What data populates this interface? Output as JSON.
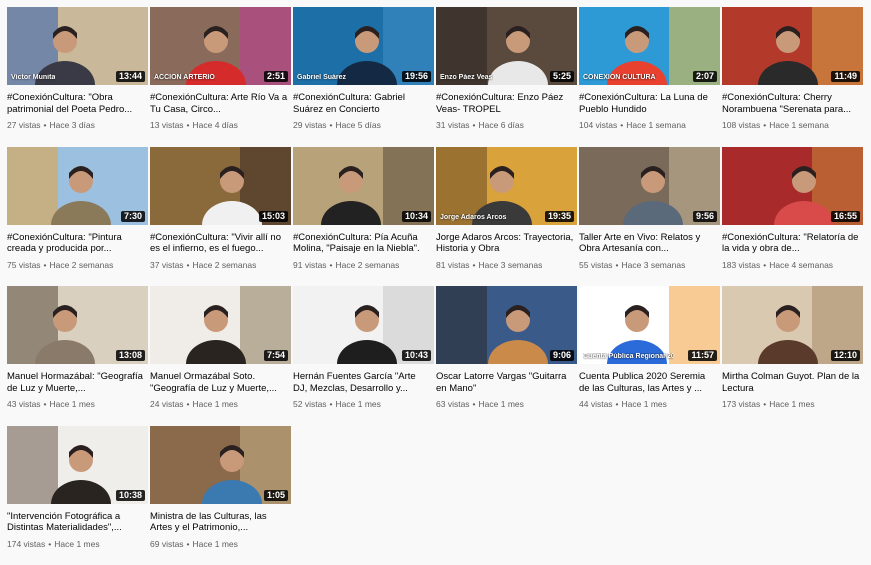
{
  "videos": [
    {
      "title": "#ConexiónCultura: \"Obra patrimonial del Poeta Pedro...",
      "views": "27 vistas",
      "age": "Hace 3 días",
      "duration": "13:44",
      "thumb_colors": [
        "#c9b99a",
        "#3a3a46",
        "#2f5fb3"
      ],
      "overlay_text": "Víctor Munita"
    },
    {
      "title": "#ConexiónCultura: Arte Río Va a Tu Casa, Circo...",
      "views": "13 vistas",
      "age": "Hace 4 días",
      "duration": "2:51",
      "thumb_colors": [
        "#8a6a5a",
        "#d62b2b",
        "#c23a9a"
      ],
      "overlay_text": "ACCIÓN ARTERIO"
    },
    {
      "title": "#ConexiónCultura: Gabriel Suárez en Concierto",
      "views": "29 vistas",
      "age": "Hace 5 días",
      "duration": "19:56",
      "thumb_colors": [
        "#1d6fa8",
        "#142a44",
        "#3f8fc9"
      ],
      "overlay_text": "Gabriel Suárez"
    },
    {
      "title": "#ConexiónCultura: Enzo Páez Veas- TROPEL",
      "views": "31 vistas",
      "age": "Hace 6 días",
      "duration": "5:25",
      "thumb_colors": [
        "#5a4a3e",
        "#e8e8e8",
        "#2a2420"
      ],
      "overlay_text": "Enzo Páez Veas"
    },
    {
      "title": "#ConexiónCultura: La Luna de Pueblo Hundido",
      "views": "104 vistas",
      "age": "Hace 1 semana",
      "duration": "2:07",
      "thumb_colors": [
        "#2d9ad6",
        "#e8412f",
        "#f5c23a"
      ],
      "overlay_text": "CONEXIÓN CULTURA"
    },
    {
      "title": "#ConexiónCultura: Cherry Norambuena \"Serenata para...",
      "views": "108 vistas",
      "age": "Hace 1 semana",
      "duration": "11:49",
      "thumb_colors": [
        "#b33a2a",
        "#2a2a2a",
        "#d9a54a"
      ],
      "overlay_text": ""
    },
    {
      "title": "#ConexiónCultura: \"Pintura creada y producida por...",
      "views": "75 vistas",
      "age": "Hace 2 semanas",
      "duration": "7:30",
      "thumb_colors": [
        "#9cc0e0",
        "#8a7a5a",
        "#e8a23a"
      ],
      "overlay_text": ""
    },
    {
      "title": "#ConexiónCultura: \"Vivir allí no es el infierno, es el fuego...",
      "views": "37 vistas",
      "age": "Hace 2 semanas",
      "duration": "15:03",
      "thumb_colors": [
        "#8a6a3a",
        "#f0f0f0",
        "#3a2a24"
      ],
      "overlay_text": ""
    },
    {
      "title": "#ConexiónCultura: Pía Acuña Molina, \"Paisaje en la Niebla\".",
      "views": "91 vistas",
      "age": "Hace 2 semanas",
      "duration": "10:34",
      "thumb_colors": [
        "#b8a27a",
        "#222222",
        "#5a4a3a"
      ],
      "overlay_text": ""
    },
    {
      "title": "Jorge Adaros Arcos: Trayectoria, Historia y Obra",
      "views": "81 vistas",
      "age": "Hace 3 semanas",
      "duration": "19:35",
      "thumb_colors": [
        "#d9a23a",
        "#3a3a3a",
        "#6a4a2a"
      ],
      "overlay_text": "Jorge Adaros Arcos"
    },
    {
      "title": "Taller Arte en Vivo: Relatos y Obra Artesanía con...",
      "views": "55 vistas",
      "age": "Hace 3 semanas",
      "duration": "9:56",
      "thumb_colors": [
        "#7a6a5a",
        "#5a6a7a",
        "#c9b99a"
      ],
      "overlay_text": ""
    },
    {
      "title": "#ConexiónCultura: \"Relatoría de la vida y obra de...",
      "views": "183 vistas",
      "age": "Hace 4 semanas",
      "duration": "16:55",
      "thumb_colors": [
        "#a82a2a",
        "#d94a4a",
        "#c98a3a"
      ],
      "overlay_text": ""
    },
    {
      "title": "Manuel Hormazábal: \"Geografía de Luz y Muerte,...",
      "views": "43 vistas",
      "age": "Hace 1 mes",
      "duration": "13:08",
      "thumb_colors": [
        "#d9d0c0",
        "#8a7a6a",
        "#5a4a3a"
      ],
      "overlay_text": ""
    },
    {
      "title": "Manuel Ormazábal Soto. \"Geografía de Luz y Muerte,...",
      "views": "24 vistas",
      "age": "Hace 1 mes",
      "duration": "7:54",
      "thumb_colors": [
        "#f0ede8",
        "#2a2420",
        "#8a7a5a"
      ],
      "overlay_text": ""
    },
    {
      "title": "Hernán Fuentes García \"Arte DJ, Mezclas, Desarrollo y...",
      "views": "52 vistas",
      "age": "Hace 1 mes",
      "duration": "10:43",
      "thumb_colors": [
        "#f2f2f2",
        "#1e1e1e",
        "#c8c8c8"
      ],
      "overlay_text": ""
    },
    {
      "title": "Oscar Latorre Vargas \"Guitarra en Mano\"",
      "views": "63 vistas",
      "age": "Hace 1 mes",
      "duration": "9:06",
      "thumb_colors": [
        "#3a5a8a",
        "#c98a4a",
        "#2a2a2a"
      ],
      "overlay_text": ""
    },
    {
      "title": "Cuenta Publica 2020 Seremia de las Culturas, las Artes y ...",
      "views": "44 vistas",
      "age": "Hace 1 mes",
      "duration": "11:57",
      "thumb_colors": [
        "#ffffff",
        "#2a6ad9",
        "#f0a03a"
      ],
      "overlay_text": "Cuenta Pública Regional 2020"
    },
    {
      "title": "Mirtha Colman Guyot. Plan de la Lectura",
      "views": "173 vistas",
      "age": "Hace 1 mes",
      "duration": "12:10",
      "thumb_colors": [
        "#d9c9b0",
        "#5a3a2a",
        "#a88a6a"
      ],
      "overlay_text": ""
    },
    {
      "title": "\"Intervención Fotográfica a Distintas Materialidades\",...",
      "views": "174 vistas",
      "age": "Hace 1 mes",
      "duration": "10:38",
      "thumb_colors": [
        "#f0eeea",
        "#2a2420",
        "#6a5a4a"
      ],
      "overlay_text": ""
    },
    {
      "title": "Ministra de las Culturas, las Artes y el Patrimonio,...",
      "views": "69 vistas",
      "age": "Hace 1 mes",
      "duration": "1:05",
      "thumb_colors": [
        "#8a6a4a",
        "#3a7ab0",
        "#c9b08a"
      ],
      "overlay_text": ""
    }
  ]
}
